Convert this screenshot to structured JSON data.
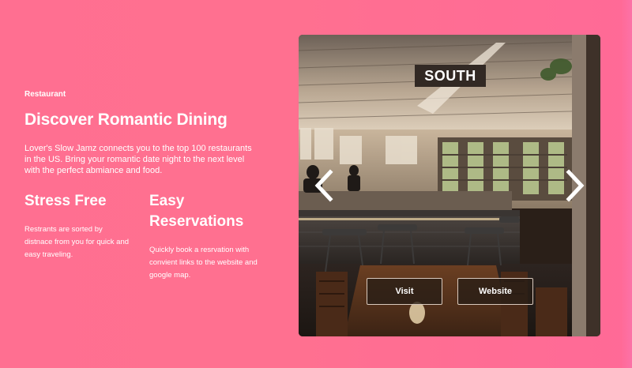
{
  "hero": {
    "eyebrow": "Restaurant",
    "title": "Discover Romantic Dining",
    "description": "Lover's Slow Jamz connects you to the top 100 restaurants in the US. Bring your romantic date night to the next level with the perfect abmiance and food."
  },
  "features": [
    {
      "title": "Stress Free",
      "text": "Restrants are sorted by distnace from you for quick and easy traveling."
    },
    {
      "title": "Easy Reservations",
      "text": "Quickly book a resrvation with convient links to the website and google map."
    }
  ],
  "slider": {
    "label": "SOUTH",
    "visit_label": "Visit",
    "website_label": "Website",
    "prev_icon": "chevron-left-icon",
    "next_icon": "chevron-right-icon"
  },
  "colors": {
    "background": "#ff6f91",
    "label_bg": "#322924",
    "button_border": "#d9c9bd"
  }
}
